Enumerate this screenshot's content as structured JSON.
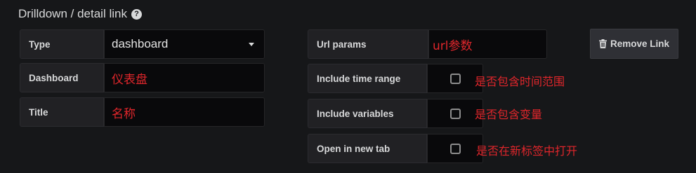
{
  "header": {
    "title": "Drilldown / detail link",
    "help_icon": "question-circle-icon"
  },
  "left": {
    "type": {
      "label": "Type",
      "value": "dashboard"
    },
    "dashboard": {
      "label": "Dashboard",
      "annotation": "仪表盘"
    },
    "title": {
      "label": "Title",
      "annotation": "名称"
    }
  },
  "right": {
    "url_params": {
      "label": "Url params",
      "annotation": "url参数"
    },
    "include_time_range": {
      "label": "Include time range",
      "checked": false,
      "annotation": "是否包含时间范围"
    },
    "include_variables": {
      "label": "Include variables",
      "checked": false,
      "annotation": "是否包含变量"
    },
    "open_new_tab": {
      "label": "Open in new tab",
      "checked": false,
      "annotation": "是否在新标签中打开"
    }
  },
  "actions": {
    "remove_link_label": "Remove Link",
    "remove_icon": "trash-icon"
  },
  "colors": {
    "annotation": "#e0262b",
    "background": "#161719"
  }
}
